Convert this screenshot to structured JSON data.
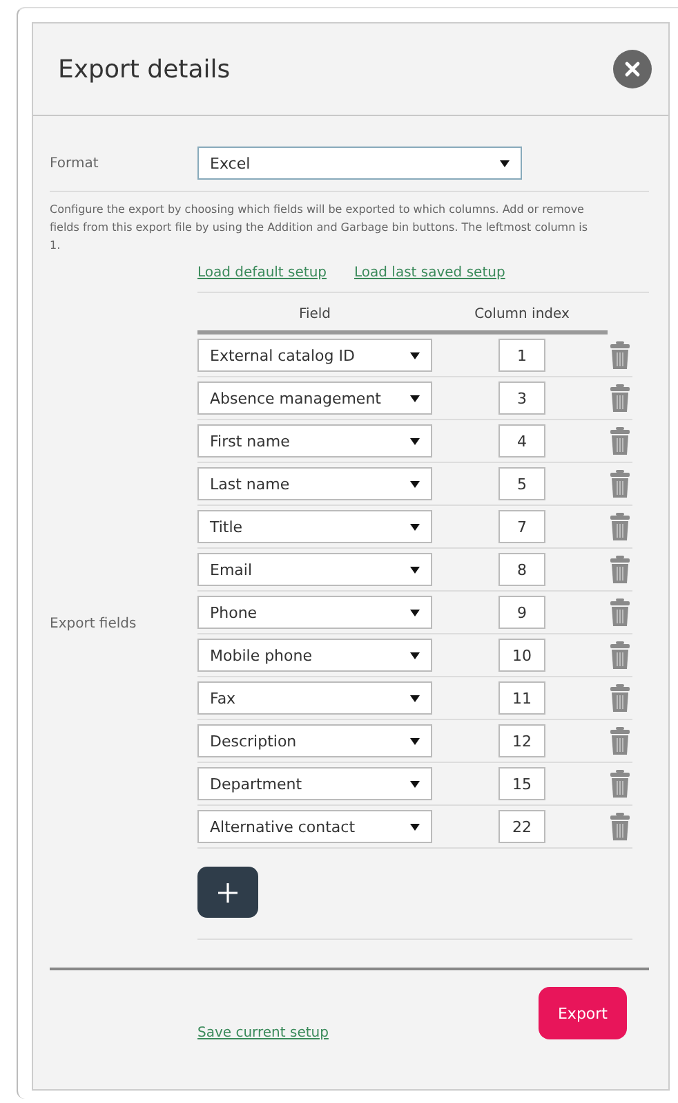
{
  "dialog": {
    "title": "Export details"
  },
  "format": {
    "label": "Format",
    "value": "Excel"
  },
  "description": "Configure the export by choosing which fields will be exported to which columns. Add or remove fields from this export file by using the Addition and Garbage bin buttons. The leftmost column is 1.",
  "links": [
    "Load default setup",
    "Load last saved setup"
  ],
  "export_fields": {
    "label": "Export fields",
    "columns": [
      "Field",
      "Column index"
    ],
    "rows": [
      {
        "field": "External catalog ID",
        "column_index": "1"
      },
      {
        "field": "Absence management",
        "column_index": "3"
      },
      {
        "field": "First name",
        "column_index": "4"
      },
      {
        "field": "Last name",
        "column_index": "5"
      },
      {
        "field": "Title",
        "column_index": "7"
      },
      {
        "field": "Email",
        "column_index": "8"
      },
      {
        "field": "Phone",
        "column_index": "9"
      },
      {
        "field": "Mobile phone",
        "column_index": "10"
      },
      {
        "field": "Fax",
        "column_index": "11"
      },
      {
        "field": "Description",
        "column_index": "12"
      },
      {
        "field": "Department",
        "column_index": "15"
      },
      {
        "field": "Alternative contact",
        "column_index": "22"
      }
    ]
  },
  "footer": {
    "save_link": "Save current setup",
    "export_button": "Export"
  }
}
